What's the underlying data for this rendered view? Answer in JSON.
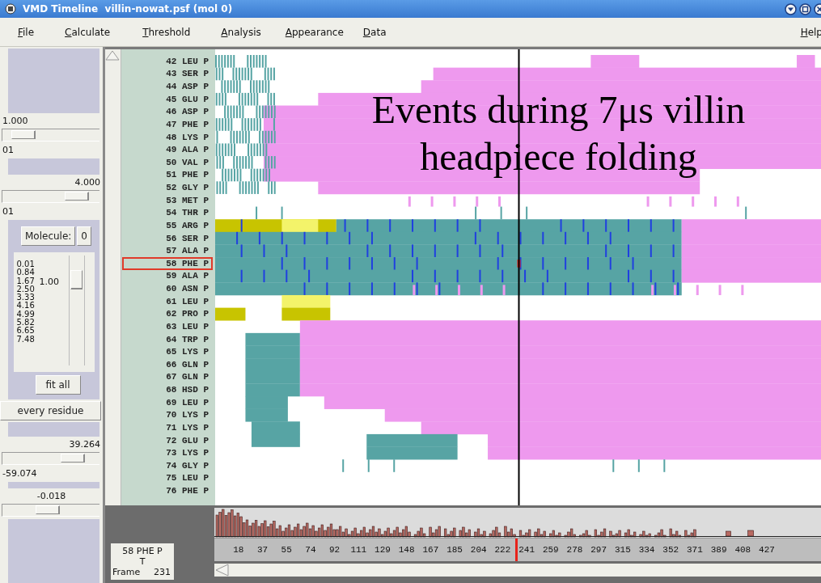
{
  "window": {
    "title": "VMD Timeline  villin-nowat.psf (mol 0)"
  },
  "menu": [
    {
      "label": "File"
    },
    {
      "label": "Calculate"
    },
    {
      "label": "Threshold"
    },
    {
      "label": "Analysis"
    },
    {
      "label": "Appearance"
    },
    {
      "label": "Data"
    }
  ],
  "help_menu": {
    "label": "Help"
  },
  "scale_1": {
    "value": "1.000",
    "level": 0.12,
    "caption": "01"
  },
  "scale_2": {
    "value": "4.000",
    "level": 0.86,
    "caption": "01"
  },
  "molecule": {
    "label": "Molecule:",
    "value": "0"
  },
  "threshold_list": {
    "items": [
      "0.01",
      "0.84",
      "1.67",
      "2.50",
      "3.33",
      "4.16",
      "4.99",
      "5.82",
      "6.65",
      "7.48"
    ],
    "value": "1.00",
    "level": 0.84
  },
  "fit_button": {
    "label": "fit all"
  },
  "mode_button": {
    "label": "every residue"
  },
  "scale_3": {
    "max": "39.264",
    "min": "-59.074",
    "level": 0.8
  },
  "scale_4": {
    "value": "-0.018",
    "level": 0.45
  },
  "residues": [
    {
      "label": "42 LEU P",
      "selected": false
    },
    {
      "label": "43 SER P",
      "selected": false
    },
    {
      "label": "44 ASP P",
      "selected": false
    },
    {
      "label": "45 GLU P",
      "selected": false
    },
    {
      "label": "46 ASP P",
      "selected": false
    },
    {
      "label": "47 PHE P",
      "selected": false
    },
    {
      "label": "48 LYS P",
      "selected": false
    },
    {
      "label": "49 ALA P",
      "selected": false
    },
    {
      "label": "50 VAL P",
      "selected": false
    },
    {
      "label": "51 PHE P",
      "selected": false
    },
    {
      "label": "52 GLY P",
      "selected": false
    },
    {
      "label": "53 MET P",
      "selected": false
    },
    {
      "label": "54 THR P",
      "selected": false
    },
    {
      "label": "55 ARG P",
      "selected": false
    },
    {
      "label": "56 SER P",
      "selected": false
    },
    {
      "label": "57 ALA P",
      "selected": false
    },
    {
      "label": "58 PHE P",
      "selected": true
    },
    {
      "label": "59 ALA P",
      "selected": false
    },
    {
      "label": "60 ASN P",
      "selected": false
    },
    {
      "label": "61 LEU P",
      "selected": false
    },
    {
      "label": "62 PRO P",
      "selected": false
    },
    {
      "label": "63 LEU P",
      "selected": false
    },
    {
      "label": "64 TRP P",
      "selected": false
    },
    {
      "label": "65 LYS P",
      "selected": false
    },
    {
      "label": "66 GLN P",
      "selected": false
    },
    {
      "label": "67 GLN P",
      "selected": false
    },
    {
      "label": "68 HSD P",
      "selected": false
    },
    {
      "label": "69 LEU P",
      "selected": false
    },
    {
      "label": "70 LYS P",
      "selected": false
    },
    {
      "label": "71 LYS P",
      "selected": false
    },
    {
      "label": "72 GLU P",
      "selected": false
    },
    {
      "label": "73 LYS P",
      "selected": false
    },
    {
      "label": "74 GLY P",
      "selected": false
    },
    {
      "label": "75 LEU P",
      "selected": false
    },
    {
      "label": "76 PHE P",
      "selected": false
    }
  ],
  "annotation": {
    "text": "Events during 7μs villin headpiece folding"
  },
  "info": {
    "residue": "58 PHE P",
    "label": "T",
    "frame_label": "Frame",
    "frame": "231"
  },
  "frame_ticks": [
    "18",
    "37",
    "55",
    "74",
    "92",
    "111",
    "129",
    "148",
    "167",
    "185",
    "204",
    "222",
    "241",
    "259",
    "278",
    "297",
    "315",
    "334",
    "352",
    "371",
    "389",
    "408",
    "427"
  ]
}
